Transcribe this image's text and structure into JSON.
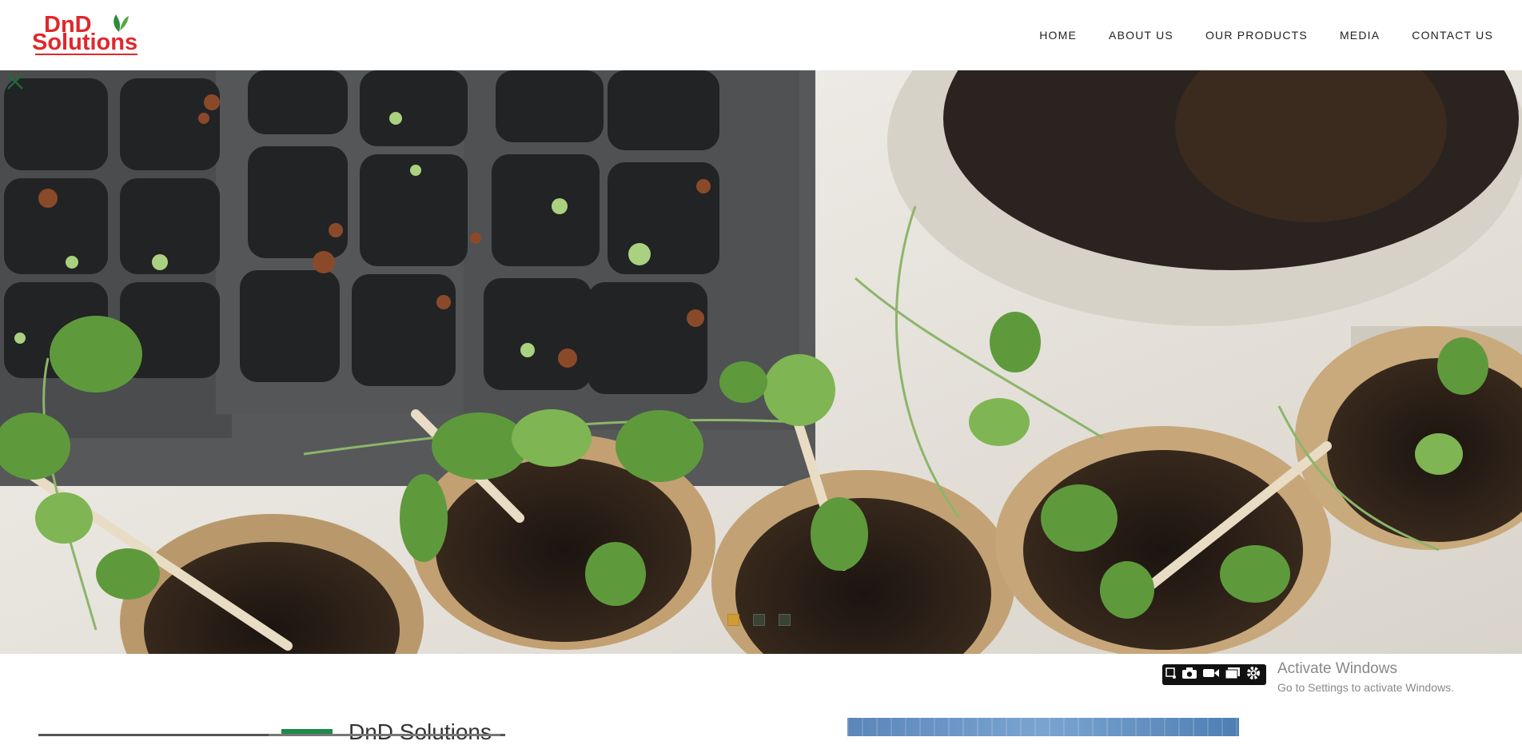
{
  "brand": {
    "logo_line1": "DnD",
    "logo_line2": "Solutions",
    "red": "#e0282c",
    "green": "#2e8b3c"
  },
  "nav": {
    "items": [
      {
        "label": "HOME"
      },
      {
        "label": "ABOUT US"
      },
      {
        "label": "OUR PRODUCTS"
      },
      {
        "label": "MEDIA"
      },
      {
        "label": "CONTACT US"
      }
    ]
  },
  "hero": {
    "slide_count": 3,
    "active_slide": 1,
    "prev_icon": "chevron-left-icon",
    "next_icon": "chevron-right-icon"
  },
  "section": {
    "title": "DnD Solutions",
    "accent": "#1d8a4a"
  },
  "recorder_toolbar": {
    "icons": [
      "screenshot-icon",
      "camera-icon",
      "video-icon",
      "window-icon",
      "gear-icon"
    ]
  },
  "watermark": {
    "title": "Activate Windows",
    "subtitle": "Go to Settings to activate Windows."
  }
}
